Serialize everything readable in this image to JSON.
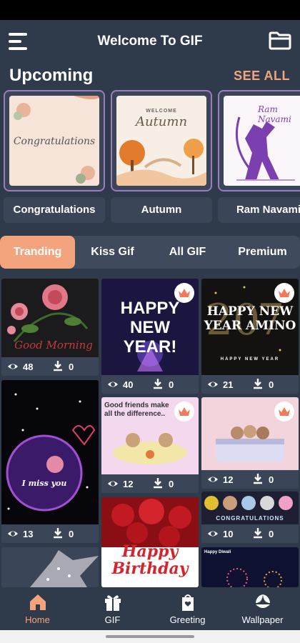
{
  "header": {
    "title": "Welcome To GIF"
  },
  "upcoming": {
    "title": "Upcoming",
    "see_all": "SEE ALL",
    "items": [
      {
        "label": "Congratulations",
        "art_text": "Congratulations"
      },
      {
        "label": "Autumn",
        "art_kicker": "WELCOME",
        "art_text": "Autumn"
      },
      {
        "label": "Ram Navami",
        "art_text": "Ram Navami"
      }
    ]
  },
  "tabs": [
    {
      "label": "Tranding",
      "active": true
    },
    {
      "label": "Kiss Gif"
    },
    {
      "label": "All GIF"
    },
    {
      "label": "Premium"
    }
  ],
  "grid": {
    "items": [
      {
        "id": "rose",
        "caption": "Good Morning",
        "views": "48",
        "downloads": "0",
        "premium": false
      },
      {
        "id": "newyear1",
        "caption": "HAPPY NEW YEAR!",
        "views": "40",
        "downloads": "0",
        "premium": true
      },
      {
        "id": "newyear2",
        "caption": "HAPPY NEW YEAR AMINO",
        "sub": "HAPPY NEW YEAR",
        "views": "21",
        "downloads": "0",
        "premium": true
      },
      {
        "id": "missyou",
        "caption": "I miss you",
        "views": "13",
        "downloads": "0",
        "premium": false
      },
      {
        "id": "friends",
        "caption": "Good friends make all the difference..",
        "views": "12",
        "downloads": "0",
        "premium": true
      },
      {
        "id": "bears",
        "caption": "",
        "views": "12",
        "downloads": "0",
        "premium": true
      },
      {
        "id": "congrats",
        "caption": "CONGRATULATIONS",
        "views": "10",
        "downloads": "0",
        "premium": false
      },
      {
        "id": "birthday",
        "caption": "Happy Birthday",
        "premium": false
      },
      {
        "id": "diwali",
        "caption": "Happy Diwali",
        "premium": false
      },
      {
        "id": "sparkle",
        "caption": "",
        "premium": false
      }
    ]
  },
  "nav": [
    {
      "label": "Home",
      "icon": "home-icon",
      "active": true
    },
    {
      "label": "GIF",
      "icon": "gift-icon"
    },
    {
      "label": "Greeting",
      "icon": "greeting-icon"
    },
    {
      "label": "Wallpaper",
      "icon": "wallpaper-icon"
    }
  ],
  "colors": {
    "accent": "#f3a47c",
    "background": "#2f3a4b",
    "card": "#3a4558",
    "border": "#9b7cc0"
  }
}
